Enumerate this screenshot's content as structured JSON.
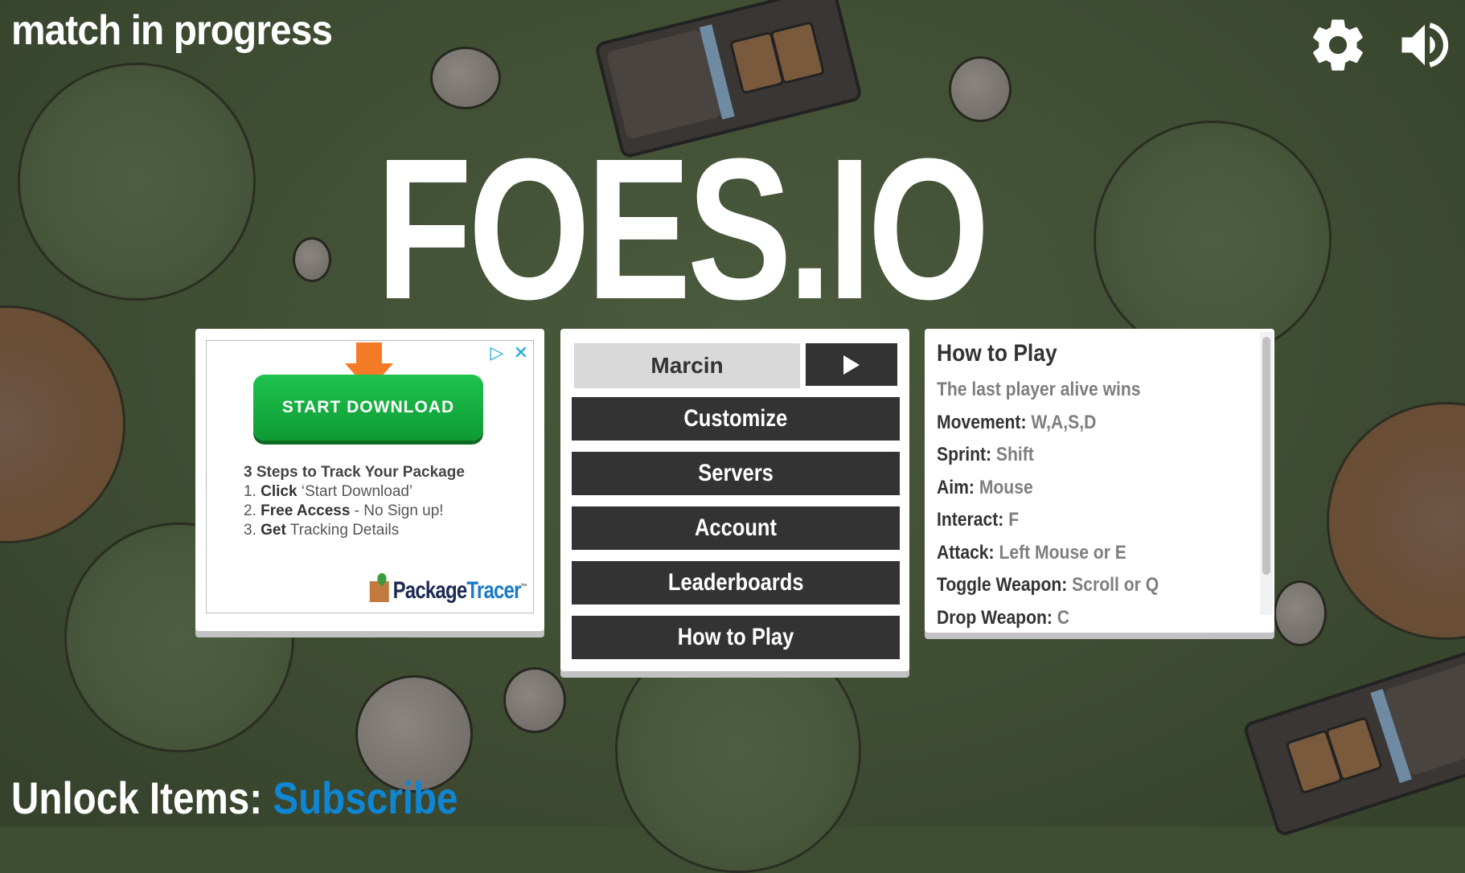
{
  "header": {
    "status": "match in progress",
    "settings_icon": "gear-icon",
    "sound_icon": "speaker-icon"
  },
  "logo": "FOES.IO",
  "ad": {
    "button_label": "START DOWNLOAD",
    "heading": "3 Steps to Track Your Package",
    "steps": [
      {
        "num": "1.",
        "bold": "Click",
        "rest": " ‘Start Download’"
      },
      {
        "num": "2.",
        "bold": "Free Access",
        "rest": " - No Sign up!"
      },
      {
        "num": "3.",
        "bold": "Get",
        "rest": " Tracking Details"
      }
    ],
    "brand_a": "Package",
    "brand_b": "Tracer",
    "brand_tm": "™",
    "adchoices_icon": "adchoices-icon",
    "close_icon": "close-icon",
    "adchoices_glyph": "▷",
    "close_glyph": "✕"
  },
  "menu": {
    "name_value": "Marcin",
    "play_icon": "play-icon",
    "buttons": [
      "Customize",
      "Servers",
      "Account",
      "Leaderboards",
      "How to Play"
    ]
  },
  "how_to_play": {
    "title": "How to Play",
    "intro": "The last player alive wins",
    "controls": [
      {
        "label": "Movement:",
        "value": "W,A,S,D"
      },
      {
        "label": "Sprint:",
        "value": "Shift"
      },
      {
        "label": "Aim:",
        "value": "Mouse"
      },
      {
        "label": "Interact:",
        "value": "F"
      },
      {
        "label": "Attack:",
        "value": "Left Mouse or E"
      },
      {
        "label": "Toggle Weapon:",
        "value": "Scroll or Q"
      },
      {
        "label": "Drop Weapon:",
        "value": "C"
      }
    ]
  },
  "footer": {
    "label": "Unlock Items:",
    "link": "Subscribe"
  },
  "colors": {
    "accent_link": "#0f86d3",
    "button_dark": "#333333",
    "grass": "#3f4d33"
  }
}
